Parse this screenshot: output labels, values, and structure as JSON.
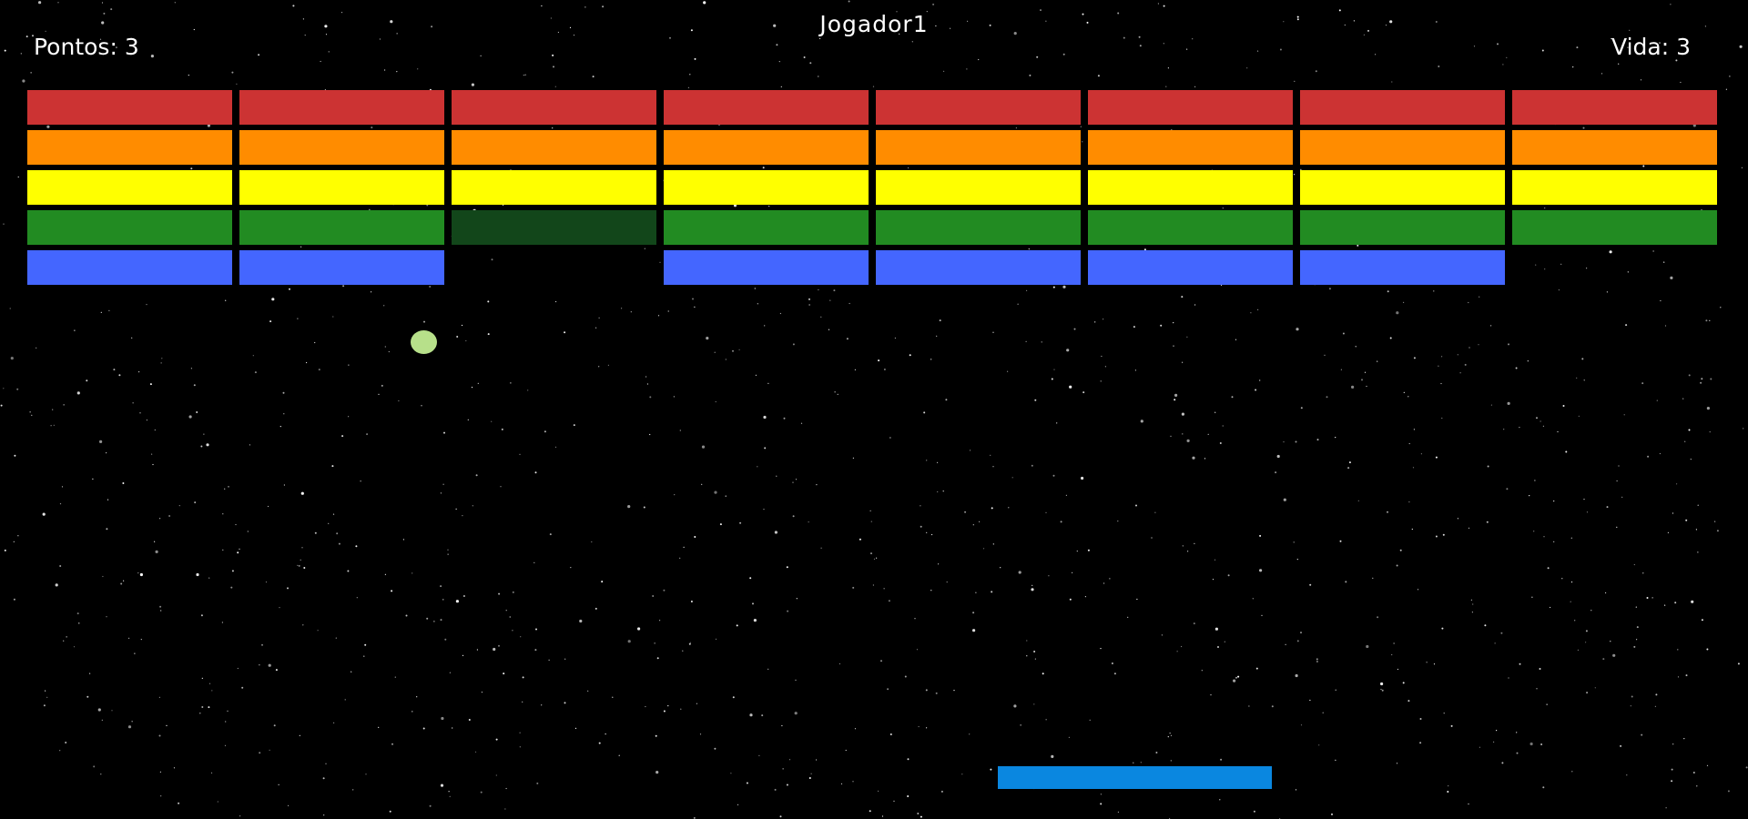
{
  "hud": {
    "score_label": "Pontos: 3",
    "player_name": "Jogador1",
    "lives_label": "Vida: 3"
  },
  "colors": {
    "background": "#000000",
    "star": "#ffffff",
    "hud_text": "#ffffff",
    "ball": "#b7e08a",
    "paddle": "#0a87e0"
  },
  "bricks": {
    "row_colors": [
      "#cc3333",
      "#ff8c00",
      "#ffff00",
      "#228b22",
      "#4466ff"
    ],
    "damaged_color": "#12461a",
    "grid": [
      [
        "intact",
        "intact",
        "intact",
        "intact",
        "intact",
        "intact",
        "intact",
        "intact"
      ],
      [
        "intact",
        "intact",
        "intact",
        "intact",
        "intact",
        "intact",
        "intact",
        "intact"
      ],
      [
        "intact",
        "intact",
        "intact",
        "intact",
        "intact",
        "intact",
        "intact",
        "intact"
      ],
      [
        "intact",
        "intact",
        "damaged",
        "intact",
        "intact",
        "intact",
        "intact",
        "intact"
      ],
      [
        "intact",
        "intact",
        "destroyed",
        "intact",
        "intact",
        "intact",
        "intact",
        "destroyed"
      ]
    ]
  }
}
